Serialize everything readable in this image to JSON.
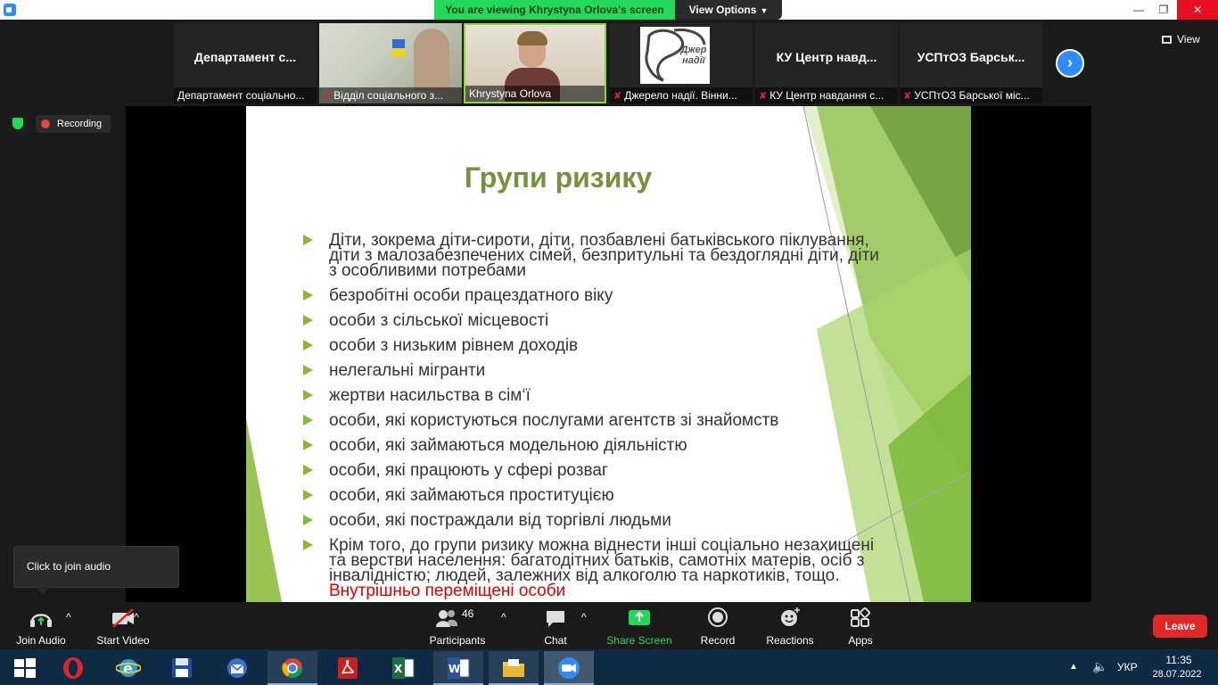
{
  "window": {
    "banner": "You are viewing Khrystyna Orlova's screen",
    "view_options": "View Options",
    "minimize": "—",
    "maximize": "❐",
    "close": "✕"
  },
  "thumbnails": [
    {
      "name": "Департамент  с...",
      "label": "Департамент соціально...",
      "muted": false
    },
    {
      "name": "",
      "label": "Відділ соціального з...",
      "muted": true
    },
    {
      "name": "",
      "label": "Khrystyna Orlova",
      "muted": false
    },
    {
      "name": "",
      "label": "Джерело надії. Вінни...",
      "muted": true,
      "logo_text": "Джер надії"
    },
    {
      "name": "КУ Центр  навд...",
      "label": "КУ Центр навдання с...",
      "muted": true
    },
    {
      "name": "УСПтОЗ  Барськ...",
      "label": "УСПтОЗ Барської міс...",
      "muted": true
    }
  ],
  "view_button": "View",
  "recording": "Recording",
  "slide": {
    "title": "Групи ризику",
    "bullets": [
      "Діти, зокрема діти-сироти, діти, позбавлені батьківського піклування, діти з малозабезпечених сімей, безпритульні та бездоглядні діти, діти з особливими потребами",
      "безробітні особи працездатного віку",
      "особи з сільської місцевості",
      "особи з низьким рівнем доходів",
      "нелегальні мігранти",
      "жертви насильства в сім‘ї",
      " особи, які користуються послугами агентств зі знайомств",
      "особи, які займаються модельною діяльністю",
      "особи, які працюють у сфері розваг",
      "особи, які займаються проституцією",
      "особи, які постраждали від торгівлі людьми"
    ],
    "last_bullet": "Крім того, до групи ризику можна віднести інші соціально незахищені та верстви населення: багатодітних батьків, самотніх матерів, осіб з інвалідністю; людей, залежних від алкоголю та наркотиків, тощо.",
    "last_bullet_red": " Внутрішньо переміщені особи",
    "title_color": "#76923c",
    "bullet_color": "#8ab832"
  },
  "tooltip": "Click to join audio",
  "toolbar": {
    "join_audio": "Join Audio",
    "start_video": "Start Video",
    "participants": "Participants",
    "participants_count": "46",
    "chat": "Chat",
    "share_screen": "Share Screen",
    "record": "Record",
    "reactions": "Reactions",
    "apps": "Apps",
    "leave": "Leave",
    "caret": "^"
  },
  "taskbar": {
    "apps": [
      "windows-start",
      "opera",
      "internet-explorer",
      "disk-saver",
      "thunderbird",
      "chrome",
      "acrobat",
      "excel",
      "word",
      "file-explorer",
      "zoom"
    ],
    "tray_chevron": "▲",
    "volume": "🔈",
    "language": "УКР",
    "time": "11:35",
    "date": "28.07.2022"
  }
}
